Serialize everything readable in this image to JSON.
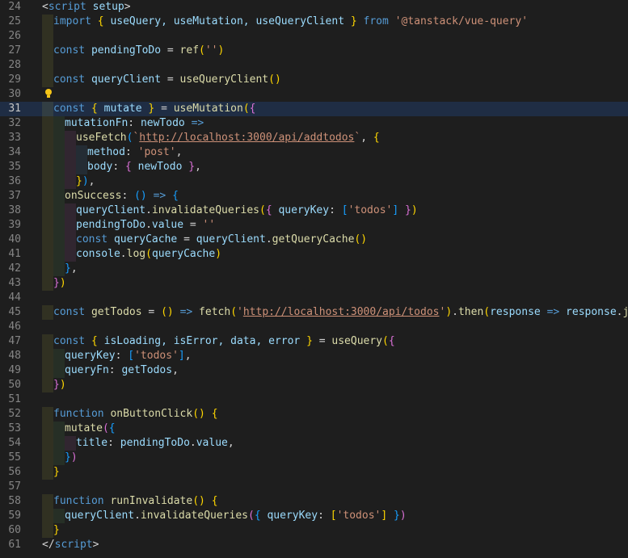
{
  "editor": {
    "lines": [
      {
        "n": "24",
        "ind": [],
        "tokens": [
          {
            "t": "<",
            "c": "tag"
          },
          {
            "t": "script",
            "c": "kw"
          },
          {
            "t": " ",
            "c": "op"
          },
          {
            "t": "setup",
            "c": "attr"
          },
          {
            "t": ">",
            "c": "tag"
          }
        ]
      },
      {
        "n": "25",
        "ind": [
          "g1"
        ],
        "tokens": [
          {
            "t": "import",
            "c": "kw"
          },
          {
            "t": " ",
            "c": "op"
          },
          {
            "t": "{",
            "c": "p1"
          },
          {
            "t": " useQuery, useMutation, useQueryClient ",
            "c": "var"
          },
          {
            "t": "}",
            "c": "p1"
          },
          {
            "t": " ",
            "c": "op"
          },
          {
            "t": "from",
            "c": "kw"
          },
          {
            "t": " ",
            "c": "op"
          },
          {
            "t": "'@tanstack/vue-query'",
            "c": "str"
          }
        ]
      },
      {
        "n": "26",
        "ind": [
          "g1"
        ],
        "tokens": []
      },
      {
        "n": "27",
        "ind": [
          "g1"
        ],
        "tokens": [
          {
            "t": "const",
            "c": "kw"
          },
          {
            "t": " ",
            "c": "op"
          },
          {
            "t": "pendingToDo",
            "c": "var"
          },
          {
            "t": " = ",
            "c": "op"
          },
          {
            "t": "ref",
            "c": "fn"
          },
          {
            "t": "(",
            "c": "p1"
          },
          {
            "t": "''",
            "c": "str"
          },
          {
            "t": ")",
            "c": "p1"
          }
        ]
      },
      {
        "n": "28",
        "ind": [
          "g1"
        ],
        "tokens": []
      },
      {
        "n": "29",
        "ind": [
          "g1"
        ],
        "tokens": [
          {
            "t": "const",
            "c": "kw"
          },
          {
            "t": " ",
            "c": "op"
          },
          {
            "t": "queryClient",
            "c": "var"
          },
          {
            "t": " = ",
            "c": "op"
          },
          {
            "t": "useQueryClient",
            "c": "fn"
          },
          {
            "t": "()",
            "c": "p1"
          }
        ]
      },
      {
        "n": "30",
        "ind": [],
        "bulb": true,
        "tokens": []
      },
      {
        "n": "31",
        "ind": [
          "g1"
        ],
        "current": true,
        "tokens": [
          {
            "t": "const",
            "c": "kw"
          },
          {
            "t": " ",
            "c": "op"
          },
          {
            "t": "{",
            "c": "p1"
          },
          {
            "t": " mutate ",
            "c": "var"
          },
          {
            "t": "}",
            "c": "p1"
          },
          {
            "t": " = ",
            "c": "op"
          },
          {
            "t": "useMutation",
            "c": "fn"
          },
          {
            "t": "(",
            "c": "p1"
          },
          {
            "t": "{",
            "c": "p2"
          }
        ]
      },
      {
        "n": "32",
        "ind": [
          "g1",
          "g2"
        ],
        "tokens": [
          {
            "t": "mutationFn",
            "c": "prop"
          },
          {
            "t": ": ",
            "c": "op"
          },
          {
            "t": "newTodo",
            "c": "var"
          },
          {
            "t": " ",
            "c": "op"
          },
          {
            "t": "=>",
            "c": "kw"
          }
        ]
      },
      {
        "n": "33",
        "ind": [
          "g1",
          "g2",
          "g3"
        ],
        "tokens": [
          {
            "t": "useFetch",
            "c": "fn"
          },
          {
            "t": "(",
            "c": "p3"
          },
          {
            "t": "`",
            "c": "str"
          },
          {
            "t": "http://localhost:3000/api/addtodos",
            "c": "url"
          },
          {
            "t": "`",
            "c": "str"
          },
          {
            "t": ", ",
            "c": "op"
          },
          {
            "t": "{",
            "c": "p1"
          }
        ]
      },
      {
        "n": "34",
        "ind": [
          "g1",
          "g2",
          "g3",
          "g4"
        ],
        "tokens": [
          {
            "t": "method",
            "c": "prop"
          },
          {
            "t": ": ",
            "c": "op"
          },
          {
            "t": "'post'",
            "c": "str"
          },
          {
            "t": ",",
            "c": "op"
          }
        ]
      },
      {
        "n": "35",
        "ind": [
          "g1",
          "g2",
          "g3",
          "g4"
        ],
        "tokens": [
          {
            "t": "body",
            "c": "prop"
          },
          {
            "t": ": ",
            "c": "op"
          },
          {
            "t": "{",
            "c": "p2"
          },
          {
            "t": " newTodo ",
            "c": "var"
          },
          {
            "t": "}",
            "c": "p2"
          },
          {
            "t": ",",
            "c": "op"
          }
        ]
      },
      {
        "n": "36",
        "ind": [
          "g1",
          "g2",
          "g3"
        ],
        "tokens": [
          {
            "t": "}",
            "c": "p1"
          },
          {
            "t": ")",
            "c": "p3"
          },
          {
            "t": ",",
            "c": "op"
          }
        ]
      },
      {
        "n": "37",
        "ind": [
          "g1",
          "g2"
        ],
        "tokens": [
          {
            "t": "onSuccess",
            "c": "fn"
          },
          {
            "t": ": ",
            "c": "op"
          },
          {
            "t": "()",
            "c": "p3"
          },
          {
            "t": " ",
            "c": "op"
          },
          {
            "t": "=>",
            "c": "kw"
          },
          {
            "t": " ",
            "c": "op"
          },
          {
            "t": "{",
            "c": "p3"
          }
        ]
      },
      {
        "n": "38",
        "ind": [
          "g1",
          "g2",
          "g3"
        ],
        "tokens": [
          {
            "t": "queryClient",
            "c": "var"
          },
          {
            "t": ".",
            "c": "op"
          },
          {
            "t": "invalidateQueries",
            "c": "fn"
          },
          {
            "t": "(",
            "c": "p1"
          },
          {
            "t": "{",
            "c": "p2"
          },
          {
            "t": " ",
            "c": "op"
          },
          {
            "t": "queryKey",
            "c": "prop"
          },
          {
            "t": ": ",
            "c": "op"
          },
          {
            "t": "[",
            "c": "p3"
          },
          {
            "t": "'todos'",
            "c": "str"
          },
          {
            "t": "]",
            "c": "p3"
          },
          {
            "t": " ",
            "c": "op"
          },
          {
            "t": "}",
            "c": "p2"
          },
          {
            "t": ")",
            "c": "p1"
          }
        ]
      },
      {
        "n": "39",
        "ind": [
          "g1",
          "g2",
          "g3"
        ],
        "tokens": [
          {
            "t": "pendingToDo",
            "c": "var"
          },
          {
            "t": ".",
            "c": "op"
          },
          {
            "t": "value",
            "c": "prop"
          },
          {
            "t": " = ",
            "c": "op"
          },
          {
            "t": "''",
            "c": "str"
          }
        ]
      },
      {
        "n": "40",
        "ind": [
          "g1",
          "g2",
          "g3"
        ],
        "tokens": [
          {
            "t": "const",
            "c": "kw"
          },
          {
            "t": " ",
            "c": "op"
          },
          {
            "t": "queryCache",
            "c": "var"
          },
          {
            "t": " = ",
            "c": "op"
          },
          {
            "t": "queryClient",
            "c": "var"
          },
          {
            "t": ".",
            "c": "op"
          },
          {
            "t": "getQueryCache",
            "c": "fn"
          },
          {
            "t": "()",
            "c": "p1"
          }
        ]
      },
      {
        "n": "41",
        "ind": [
          "g1",
          "g2",
          "g3"
        ],
        "tokens": [
          {
            "t": "console",
            "c": "var"
          },
          {
            "t": ".",
            "c": "op"
          },
          {
            "t": "log",
            "c": "fn"
          },
          {
            "t": "(",
            "c": "p1"
          },
          {
            "t": "queryCache",
            "c": "var"
          },
          {
            "t": ")",
            "c": "p1"
          }
        ]
      },
      {
        "n": "42",
        "ind": [
          "g1",
          "g2"
        ],
        "tokens": [
          {
            "t": "}",
            "c": "p3"
          },
          {
            "t": ",",
            "c": "op"
          }
        ]
      },
      {
        "n": "43",
        "ind": [
          "g1"
        ],
        "tokens": [
          {
            "t": "}",
            "c": "p2"
          },
          {
            "t": ")",
            "c": "p1"
          }
        ]
      },
      {
        "n": "44",
        "ind": [],
        "tokens": []
      },
      {
        "n": "45",
        "ind": [
          "g1"
        ],
        "tokens": [
          {
            "t": "const",
            "c": "kw"
          },
          {
            "t": " ",
            "c": "op"
          },
          {
            "t": "getTodos",
            "c": "fn"
          },
          {
            "t": " = ",
            "c": "op"
          },
          {
            "t": "()",
            "c": "p1"
          },
          {
            "t": " ",
            "c": "op"
          },
          {
            "t": "=>",
            "c": "kw"
          },
          {
            "t": " ",
            "c": "op"
          },
          {
            "t": "fetch",
            "c": "fn"
          },
          {
            "t": "(",
            "c": "p1"
          },
          {
            "t": "'",
            "c": "str"
          },
          {
            "t": "http://localhost:3000/api/todos",
            "c": "url"
          },
          {
            "t": "'",
            "c": "str"
          },
          {
            "t": ")",
            "c": "p1"
          },
          {
            "t": ".",
            "c": "op"
          },
          {
            "t": "then",
            "c": "fn"
          },
          {
            "t": "(",
            "c": "p1"
          },
          {
            "t": "response",
            "c": "var"
          },
          {
            "t": " ",
            "c": "op"
          },
          {
            "t": "=>",
            "c": "kw"
          },
          {
            "t": " ",
            "c": "op"
          },
          {
            "t": "response",
            "c": "var"
          },
          {
            "t": ".",
            "c": "op"
          },
          {
            "t": "json",
            "c": "fn"
          },
          {
            "t": "()",
            "c": "p2"
          },
          {
            "t": ")",
            "c": "p1"
          }
        ]
      },
      {
        "n": "46",
        "ind": [],
        "tokens": []
      },
      {
        "n": "47",
        "ind": [
          "g1"
        ],
        "tokens": [
          {
            "t": "const",
            "c": "kw"
          },
          {
            "t": " ",
            "c": "op"
          },
          {
            "t": "{",
            "c": "p1"
          },
          {
            "t": " isLoading, isError, data, error ",
            "c": "var"
          },
          {
            "t": "}",
            "c": "p1"
          },
          {
            "t": " = ",
            "c": "op"
          },
          {
            "t": "useQuery",
            "c": "fn"
          },
          {
            "t": "(",
            "c": "p1"
          },
          {
            "t": "{",
            "c": "p2"
          }
        ]
      },
      {
        "n": "48",
        "ind": [
          "g1",
          "g2"
        ],
        "tokens": [
          {
            "t": "queryKey",
            "c": "prop"
          },
          {
            "t": ": ",
            "c": "op"
          },
          {
            "t": "[",
            "c": "p3"
          },
          {
            "t": "'todos'",
            "c": "str"
          },
          {
            "t": "]",
            "c": "p3"
          },
          {
            "t": ",",
            "c": "op"
          }
        ]
      },
      {
        "n": "49",
        "ind": [
          "g1",
          "g2"
        ],
        "tokens": [
          {
            "t": "queryFn",
            "c": "prop"
          },
          {
            "t": ": ",
            "c": "op"
          },
          {
            "t": "getTodos",
            "c": "var"
          },
          {
            "t": ",",
            "c": "op"
          }
        ]
      },
      {
        "n": "50",
        "ind": [
          "g1"
        ],
        "tokens": [
          {
            "t": "}",
            "c": "p2"
          },
          {
            "t": ")",
            "c": "p1"
          }
        ]
      },
      {
        "n": "51",
        "ind": [],
        "tokens": []
      },
      {
        "n": "52",
        "ind": [
          "g1"
        ],
        "tokens": [
          {
            "t": "function",
            "c": "kw"
          },
          {
            "t": " ",
            "c": "op"
          },
          {
            "t": "onButtonClick",
            "c": "fn"
          },
          {
            "t": "()",
            "c": "p1"
          },
          {
            "t": " ",
            "c": "op"
          },
          {
            "t": "{",
            "c": "p1"
          }
        ]
      },
      {
        "n": "53",
        "ind": [
          "g1",
          "g2"
        ],
        "tokens": [
          {
            "t": "mutate",
            "c": "fn"
          },
          {
            "t": "(",
            "c": "p2"
          },
          {
            "t": "{",
            "c": "p3"
          }
        ]
      },
      {
        "n": "54",
        "ind": [
          "g1",
          "g2",
          "g3"
        ],
        "tokens": [
          {
            "t": "title",
            "c": "prop"
          },
          {
            "t": ": ",
            "c": "op"
          },
          {
            "t": "pendingToDo",
            "c": "var"
          },
          {
            "t": ".",
            "c": "op"
          },
          {
            "t": "value",
            "c": "prop"
          },
          {
            "t": ",",
            "c": "op"
          }
        ]
      },
      {
        "n": "55",
        "ind": [
          "g1",
          "g2"
        ],
        "tokens": [
          {
            "t": "}",
            "c": "p3"
          },
          {
            "t": ")",
            "c": "p2"
          }
        ]
      },
      {
        "n": "56",
        "ind": [
          "g1"
        ],
        "tokens": [
          {
            "t": "}",
            "c": "p1"
          }
        ]
      },
      {
        "n": "57",
        "ind": [],
        "tokens": []
      },
      {
        "n": "58",
        "ind": [
          "g1"
        ],
        "tokens": [
          {
            "t": "function",
            "c": "kw"
          },
          {
            "t": " ",
            "c": "op"
          },
          {
            "t": "runInvalidate",
            "c": "fn"
          },
          {
            "t": "()",
            "c": "p1"
          },
          {
            "t": " ",
            "c": "op"
          },
          {
            "t": "{",
            "c": "p1"
          }
        ]
      },
      {
        "n": "59",
        "ind": [
          "g1",
          "g2"
        ],
        "tokens": [
          {
            "t": "queryClient",
            "c": "var"
          },
          {
            "t": ".",
            "c": "op"
          },
          {
            "t": "invalidateQueries",
            "c": "fn"
          },
          {
            "t": "(",
            "c": "p2"
          },
          {
            "t": "{",
            "c": "p3"
          },
          {
            "t": " ",
            "c": "op"
          },
          {
            "t": "queryKey",
            "c": "prop"
          },
          {
            "t": ": ",
            "c": "op"
          },
          {
            "t": "[",
            "c": "p1"
          },
          {
            "t": "'todos'",
            "c": "str"
          },
          {
            "t": "]",
            "c": "p1"
          },
          {
            "t": " ",
            "c": "op"
          },
          {
            "t": "}",
            "c": "p3"
          },
          {
            "t": ")",
            "c": "p2"
          }
        ]
      },
      {
        "n": "60",
        "ind": [
          "g1"
        ],
        "tokens": [
          {
            "t": "}",
            "c": "p1"
          }
        ]
      },
      {
        "n": "61",
        "ind": [],
        "tokens": [
          {
            "t": "</",
            "c": "tag"
          },
          {
            "t": "script",
            "c": "kw"
          },
          {
            "t": ">",
            "c": "tag"
          }
        ]
      }
    ],
    "lightbulb_icon": "lightbulb-icon",
    "colors": {
      "background": "#1e1e1e",
      "current_line": "#1f2d44",
      "line_number": "#858585"
    }
  }
}
